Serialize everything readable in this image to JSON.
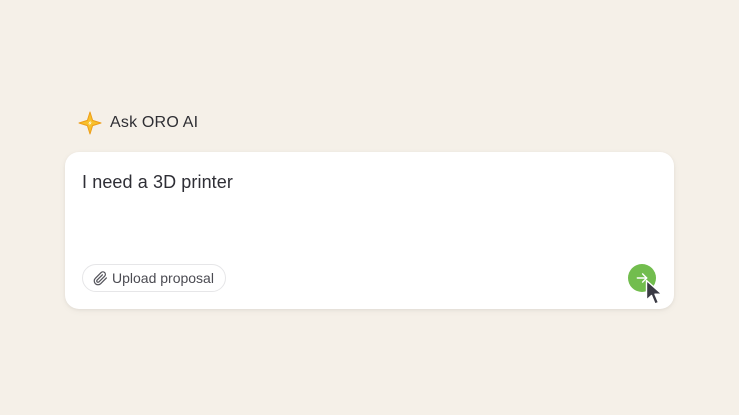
{
  "header": {
    "logo_icon": "sparkle-star-icon",
    "title": "Ask ORO AI"
  },
  "prompt": {
    "value": "I need a 3D printer"
  },
  "toolbar": {
    "upload_icon": "paperclip-icon",
    "upload_label": "Upload proposal",
    "send_icon": "arrow-right-icon"
  },
  "colors": {
    "background": "#f5f0e8",
    "send_button": "#72bd4e",
    "logo_yellow": "#f7c02c",
    "logo_orange": "#ee9d18"
  }
}
